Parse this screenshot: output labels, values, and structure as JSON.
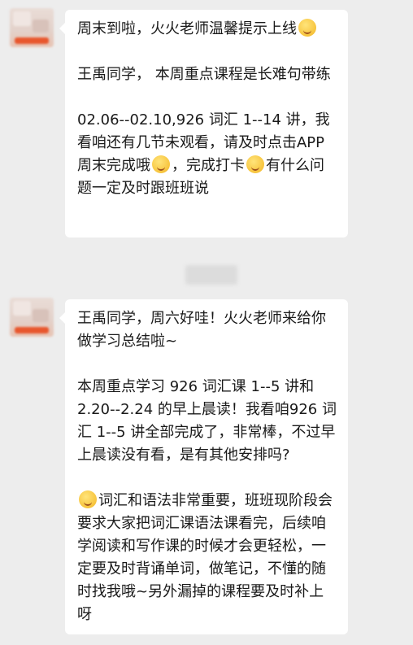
{
  "chat": {
    "messages": [
      {
        "paragraphs": [
          {
            "segments": [
              {
                "text": "周末到啦，火火老师温馨提示上线"
              },
              {
                "emoji": "ok-hand-face-emoji"
              }
            ]
          },
          {
            "segments": [
              {
                "text": "王禹同学， 本周重点课程是长难句带练"
              }
            ]
          },
          {
            "segments": [
              {
                "text": "02.06--02.10,926 词汇 1--14 讲，我看咱还有几节未观看，请及时点击APP周末完成哦"
              },
              {
                "emoji": "hug-face-emoji"
              },
              {
                "text": "，完成打卡"
              },
              {
                "emoji": "smile-face-emoji"
              },
              {
                "text": "有什么问题一定及时跟班班说"
              }
            ]
          }
        ]
      },
      {
        "paragraphs": [
          {
            "segments": [
              {
                "text": "王禹同学，周六好哇！火火老师来给你做学习总结啦~"
              }
            ]
          },
          {
            "segments": [
              {
                "text": "本周重点学习 926 词汇课 1--5 讲和2.20--2.24 的早上晨读！我看咱926 词汇 1--5 讲全部完成了，非常棒，不过早上晨读没有看，是有其他安排吗?"
              }
            ]
          },
          {
            "segments": [
              {
                "emoji": "wink-face-emoji"
              },
              {
                "text": "词汇和语法非常重要，班班现阶段会要求大家把词汇课语法课看完，后续咱学阅读和写作课的时候才会更轻松，一定要及时背诵单词，做笔记，不懂的随时找我哦~另外漏掉的课程要及时补上呀"
              }
            ]
          }
        ]
      }
    ]
  },
  "colors": {
    "background": "#ededed",
    "bubble": "#ffffff",
    "text": "#1a1a1a",
    "avatar_accent": "#e8572e"
  }
}
